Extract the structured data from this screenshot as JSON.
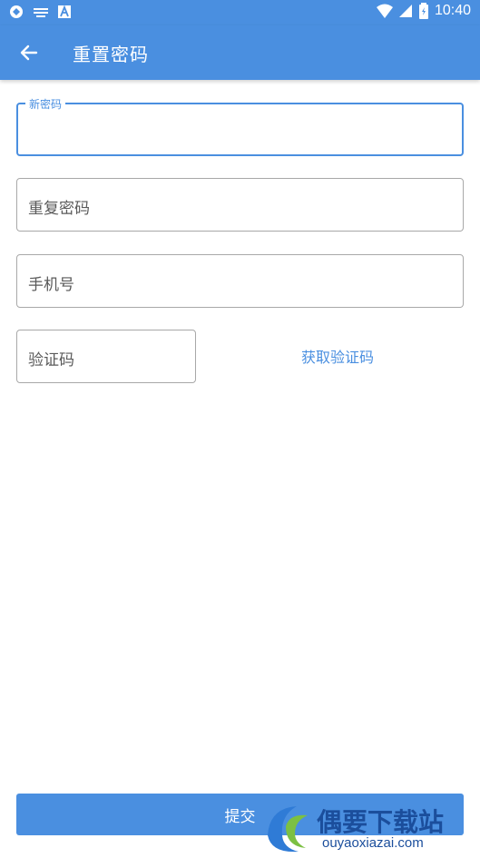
{
  "status_bar": {
    "time": "10:40",
    "icons": [
      "sync-icon",
      "keyboard-icon",
      "a-icon",
      "wifi-icon",
      "signal-icon",
      "battery-icon"
    ]
  },
  "app_bar": {
    "title": "重置密码",
    "back_icon": "arrow-left-icon"
  },
  "form": {
    "new_password": {
      "label": "新密码",
      "value": ""
    },
    "repeat_password": {
      "placeholder": "重复密码"
    },
    "phone": {
      "placeholder": "手机号"
    },
    "code": {
      "placeholder": "验证码"
    },
    "get_code_label": "获取验证码"
  },
  "submit_label": "提交",
  "watermark": {
    "text": "偶要下载站",
    "url": "ouyaoxiazai.com"
  },
  "colors": {
    "accent": "#4a8fe0",
    "border": "#a8a8a8",
    "text": "#5a5a5a"
  }
}
